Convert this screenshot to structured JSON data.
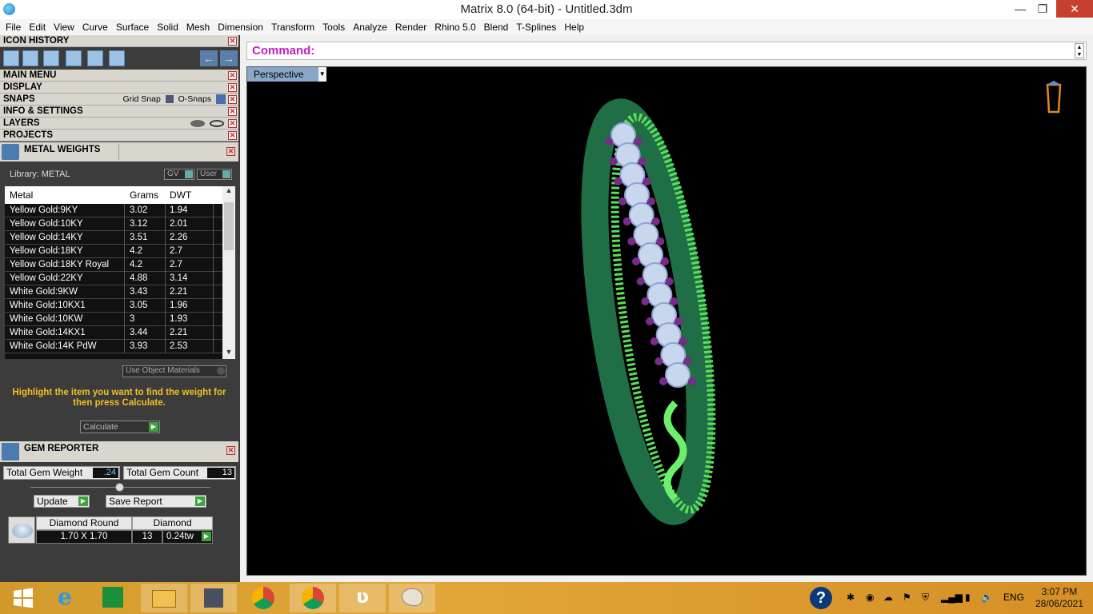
{
  "window": {
    "title": "Matrix 8.0 (64-bit) - Untitled.3dm",
    "controls": {
      "minimize": "—",
      "restore": "❐",
      "close": "✕"
    }
  },
  "menu": [
    "File",
    "Edit",
    "View",
    "Curve",
    "Surface",
    "Solid",
    "Mesh",
    "Dimension",
    "Transform",
    "Tools",
    "Analyze",
    "Render",
    "Rhino 5.0",
    "Blend",
    "T-Splines",
    "Help"
  ],
  "panels": {
    "icon_history": "ICON HISTORY",
    "main_menu": "MAIN MENU",
    "display": "DISPLAY",
    "snaps": "SNAPS",
    "grid_snap": "Grid Snap",
    "o_snaps": "O-Snaps",
    "info_settings": "INFO & SETTINGS",
    "layers": "LAYERS",
    "projects": "PROJECTS",
    "close_glyph": "✕"
  },
  "metal_weights": {
    "title": "METAL WEIGHTS",
    "library_label": "Library: METAL",
    "gv_label": "GV",
    "user_label": "User",
    "columns": [
      "Metal",
      "Grams",
      "DWT"
    ],
    "rows": [
      [
        "Yellow Gold:9KY",
        "3.02",
        "1.94"
      ],
      [
        "Yellow Gold:10KY",
        "3.12",
        "2.01"
      ],
      [
        "Yellow Gold:14KY",
        "3.51",
        "2.26"
      ],
      [
        "Yellow Gold:18KY",
        "4.2",
        "2.7"
      ],
      [
        "Yellow Gold:18KY Royal",
        "4.2",
        "2.7"
      ],
      [
        "Yellow Gold:22KY",
        "4.88",
        "3.14"
      ],
      [
        "White Gold:9KW",
        "3.43",
        "2.21"
      ],
      [
        "White Gold:10KX1",
        "3.05",
        "1.96"
      ],
      [
        "White Gold:10KW",
        "3",
        "1.93"
      ],
      [
        "White Gold:14KX1",
        "3.44",
        "2.21"
      ],
      [
        "White Gold:14K PdW",
        "3.93",
        "2.53"
      ]
    ],
    "use_object_materials": "Use Object Materials",
    "highlight_message": "Highlight the item you want to find the weight for then press Calculate.",
    "calculate_label": "Calculate"
  },
  "gem_reporter": {
    "title": "GEM REPORTER",
    "total_weight_label": "Total Gem Weight",
    "total_weight_value": ".24",
    "total_count_label": "Total Gem Count",
    "total_count_value": "13",
    "update_label": "Update",
    "save_report_label": "Save Report",
    "gem_shape": "Diamond Round",
    "gem_type": "Diamond",
    "gem_size": "1.70 X 1.70",
    "gem_count": "13",
    "gem_weight": "0.24tw"
  },
  "command": {
    "label": "Command:"
  },
  "viewport": {
    "label": "Perspective"
  },
  "taskbar": {
    "language": "ENG",
    "time": "3:07 PM",
    "date": "28/06/2021"
  }
}
